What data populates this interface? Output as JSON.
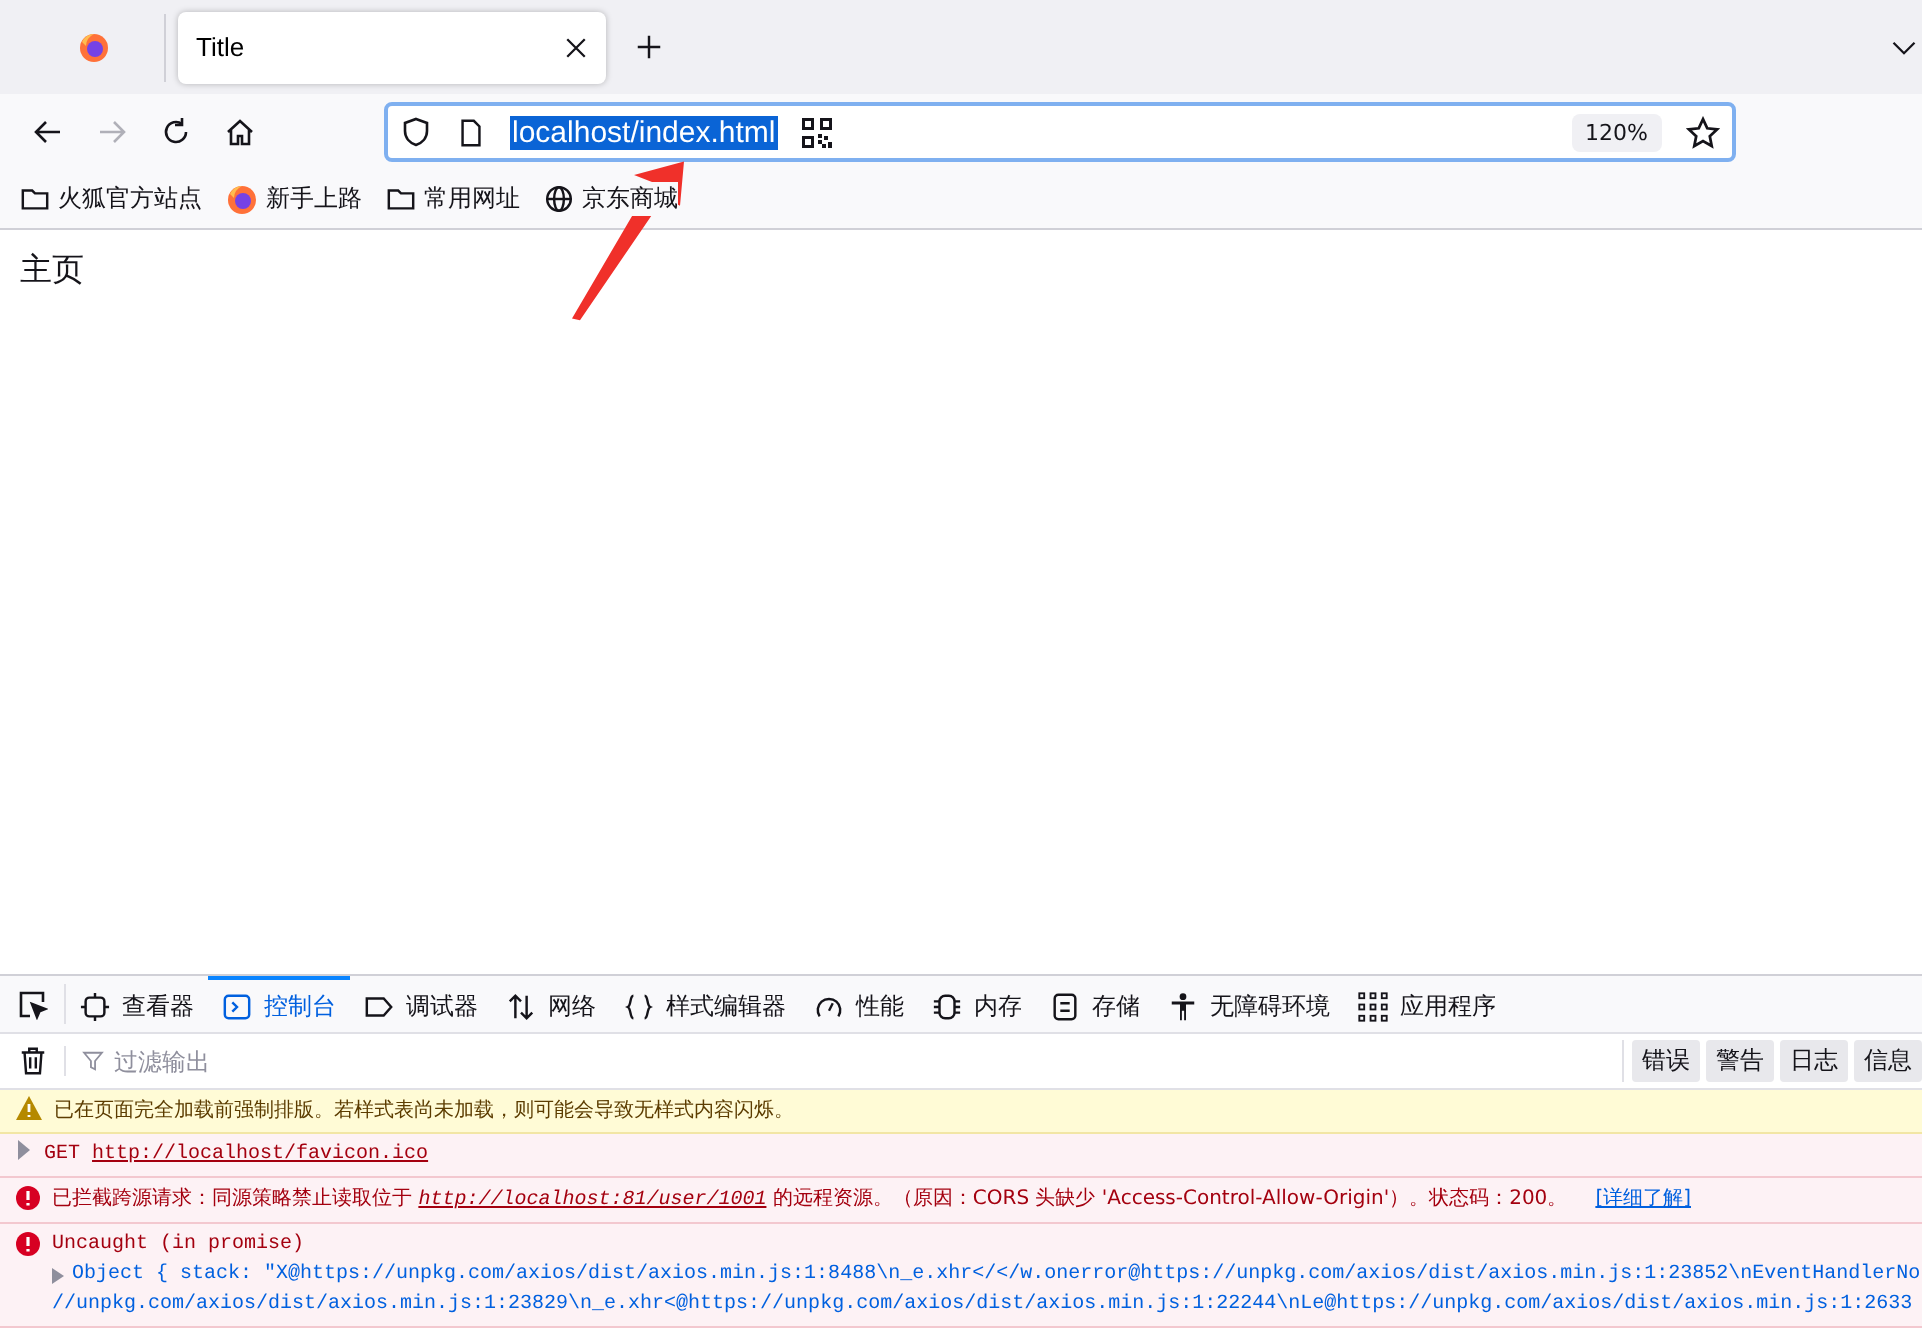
{
  "browser_tabs": [
    {
      "title": "Title",
      "selected": true
    }
  ],
  "nav_buttons": [
    {
      "kind": "back",
      "disabled": false
    },
    {
      "kind": "forward",
      "disabled": true
    },
    {
      "kind": "reload",
      "disabled": false
    },
    {
      "kind": "home",
      "disabled": false
    }
  ],
  "address_bar": {
    "url": "localhost/index.html",
    "url_selected": true,
    "zoom": "120%"
  },
  "bookmarks": [
    {
      "label": "火狐官方站点",
      "kind": "folder"
    },
    {
      "label": "新手上路",
      "kind": "firefox"
    },
    {
      "label": "常用网址",
      "kind": "folder"
    },
    {
      "label": "京东商城",
      "kind": "globe"
    }
  ],
  "page": {
    "heading": "主页"
  },
  "devtools": {
    "tabs": [
      {
        "label": "查看器",
        "kind": "inspector",
        "selected": false
      },
      {
        "label": "控制台",
        "kind": "console",
        "selected": true
      },
      {
        "label": "调试器",
        "kind": "debugger",
        "selected": false
      },
      {
        "label": "网络",
        "kind": "network",
        "selected": false
      },
      {
        "label": "样式编辑器",
        "kind": "style",
        "selected": false
      },
      {
        "label": "性能",
        "kind": "performance",
        "selected": false
      },
      {
        "label": "内存",
        "kind": "memory",
        "selected": false
      },
      {
        "label": "存储",
        "kind": "storage",
        "selected": false
      },
      {
        "label": "无障碍环境",
        "kind": "accessibility",
        "selected": false
      },
      {
        "label": "应用程序",
        "kind": "application",
        "selected": false
      }
    ],
    "filter": {
      "placeholder": "过滤输出"
    },
    "levels": [
      {
        "label": "错误"
      },
      {
        "label": "警告"
      },
      {
        "label": "日志"
      },
      {
        "label": "信息"
      }
    ],
    "messages": [
      {
        "kind": "warning",
        "text": "已在页面完全加载前强制排版。若样式表尚未加载，则可能会导致无样式内容闪烁。"
      },
      {
        "kind": "network",
        "method": "GET",
        "url": "http://localhost/favicon.ico"
      },
      {
        "kind": "error",
        "text_before": "已拦截跨源请求：同源策略禁止读取位于 ",
        "link": "http://localhost:81/user/1001",
        "text_after": " 的远程资源。（原因：CORS 头缺少 'Access-Control-Allow-Origin'）。状态码：200。",
        "learn_more": "[详细了解]"
      },
      {
        "kind": "exception",
        "title": "Uncaught (in promise)",
        "object": "Object { stack: \"X@https://unpkg.com/axios/dist/axios.min.js:1:8488\\n_e.xhr</</w.onerror@https://unpkg.com/axios/dist/axios.min.js:1:23852\\nEventHandlerNo",
        "continuation": "//unpkg.com/axios/dist/axios.min.js:1:23829\\n_e.xhr<@https://unpkg.com/axios/dist/axios.min.js:1:22244\\nLe@https://unpkg.com/axios/dist/axios.min.js:1:2633"
      }
    ]
  }
}
